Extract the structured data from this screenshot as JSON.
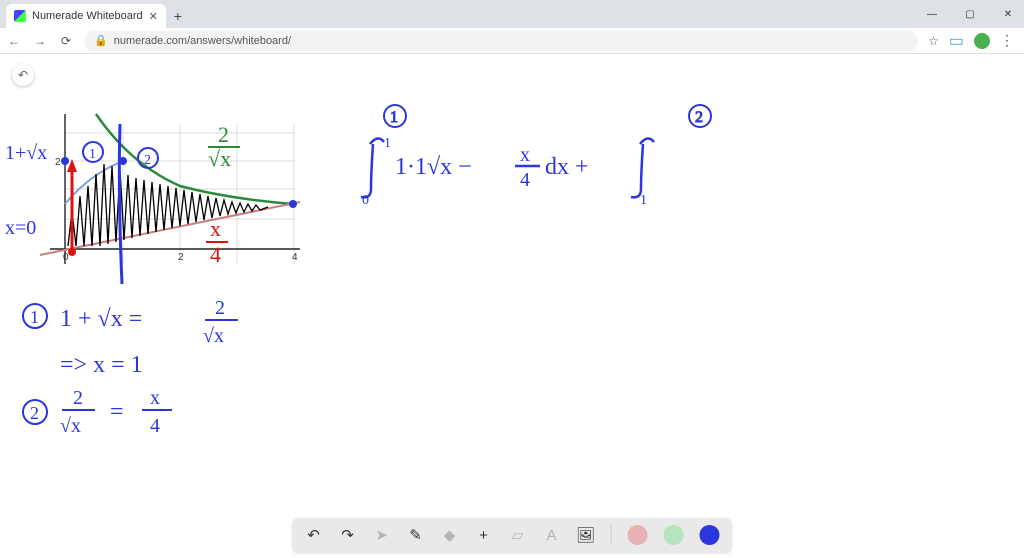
{
  "browser": {
    "tab_title": "Numerade Whiteboard",
    "url": "numerade.com/answers/whiteboard/",
    "window_controls": {
      "min": "—",
      "max": "▢",
      "close": "✕"
    }
  },
  "toolbar": {
    "undo": "↶",
    "redo": "↷",
    "pointer": "▲",
    "pen": "✎",
    "shape": "▲",
    "plus": "+",
    "eraser": "▱",
    "text": "A",
    "image": "🖼",
    "colors": {
      "red": "#e8b2b4",
      "green": "#b6e4bb",
      "blue": "#2b36dc"
    }
  },
  "annotations": {
    "axis_tick_0": "0",
    "axis_tick_2": "2",
    "axis_tick_4": "4",
    "axis_y_2": "2",
    "label_1_sqrtx": "1+√x",
    "label_x_eq_0": "x=0",
    "label_2_over_sqrtx": "2/√x",
    "label_x_over_4": "x/4",
    "circle_1_top": "①",
    "circle_2_top": "②",
    "integral_expr": "∫₀¹ 1·1√x − x/4 dx  + ∫₁",
    "eq_line1": "①  1+√x  =  2/√x",
    "eq_line1b": "=>  x = 1",
    "eq_line2": "②  2/√x  =  x/4"
  },
  "chart_data": {
    "type": "line",
    "title": "",
    "xlim": [
      -0.5,
      4.5
    ],
    "ylim": [
      -0.5,
      2.5
    ],
    "x_ticks": [
      0,
      2,
      4
    ],
    "y_ticks": [
      2
    ],
    "series": [
      {
        "name": "1+√x",
        "color": "#7b9ed6",
        "x": [
          0,
          1
        ],
        "y": [
          1,
          2
        ]
      },
      {
        "name": "2/√x",
        "color": "#2a8a3a",
        "x": [
          0.5,
          1,
          2,
          3,
          4
        ],
        "y": [
          2.4,
          2,
          1.414,
          1.155,
          1
        ]
      },
      {
        "name": "x/4",
        "color": "#c97f80",
        "x": [
          -0.5,
          4
        ],
        "y": [
          -0.125,
          1
        ]
      }
    ],
    "intersections": [
      {
        "label": "①",
        "x": 1,
        "y": 2,
        "between": [
          "1+√x",
          "2/√x"
        ]
      },
      {
        "label": "②",
        "x": 4,
        "y": 1,
        "between": [
          "2/√x",
          "x/4"
        ]
      }
    ],
    "shaded_region_bounds": {
      "left_x": 0,
      "right_x": 4
    }
  }
}
